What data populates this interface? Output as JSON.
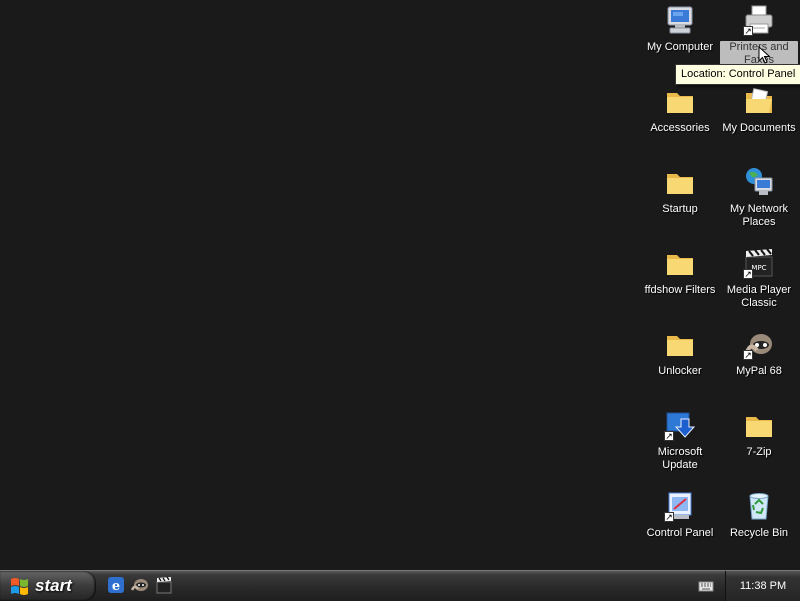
{
  "desktop": {
    "icons": [
      {
        "label": "My Computer",
        "icon": "my-computer-icon"
      },
      {
        "label": "Printers and Faxes",
        "icon": "printer-icon"
      },
      {
        "label": "Accessories",
        "icon": "folder-icon"
      },
      {
        "label": "My Documents",
        "icon": "my-documents-icon"
      },
      {
        "label": "Startup",
        "icon": "folder-icon"
      },
      {
        "label": "My Network Places",
        "icon": "network-places-icon"
      },
      {
        "label": "ffdshow Filters",
        "icon": "folder-icon"
      },
      {
        "label": "Media Player Classic",
        "icon": "clapperboard-icon"
      },
      {
        "label": "Unlocker",
        "icon": "folder-icon"
      },
      {
        "label": "MyPal 68",
        "icon": "mypal-raccoon-icon"
      },
      {
        "label": "Microsoft Update",
        "icon": "windows-update-icon"
      },
      {
        "label": "7-Zip",
        "icon": "folder-icon"
      },
      {
        "label": "Control Panel",
        "icon": "control-panel-icon"
      },
      {
        "label": "Recycle Bin",
        "icon": "recycle-bin-icon"
      }
    ],
    "tooltip": "Location: Control Panel"
  },
  "taskbar": {
    "start_label": "start",
    "quick_launch": [
      "internet-explorer-icon",
      "mypal-raccoon-icon",
      "media-player-classic-icon"
    ],
    "tray_icon": "keyboard-icon",
    "clock": "11:38 PM"
  },
  "colors": {
    "desktop_bg": "#1a1a1a",
    "folder": "#f5d36b",
    "tooltip_bg": "#ffffe1",
    "selection": "#bdbdbd"
  }
}
